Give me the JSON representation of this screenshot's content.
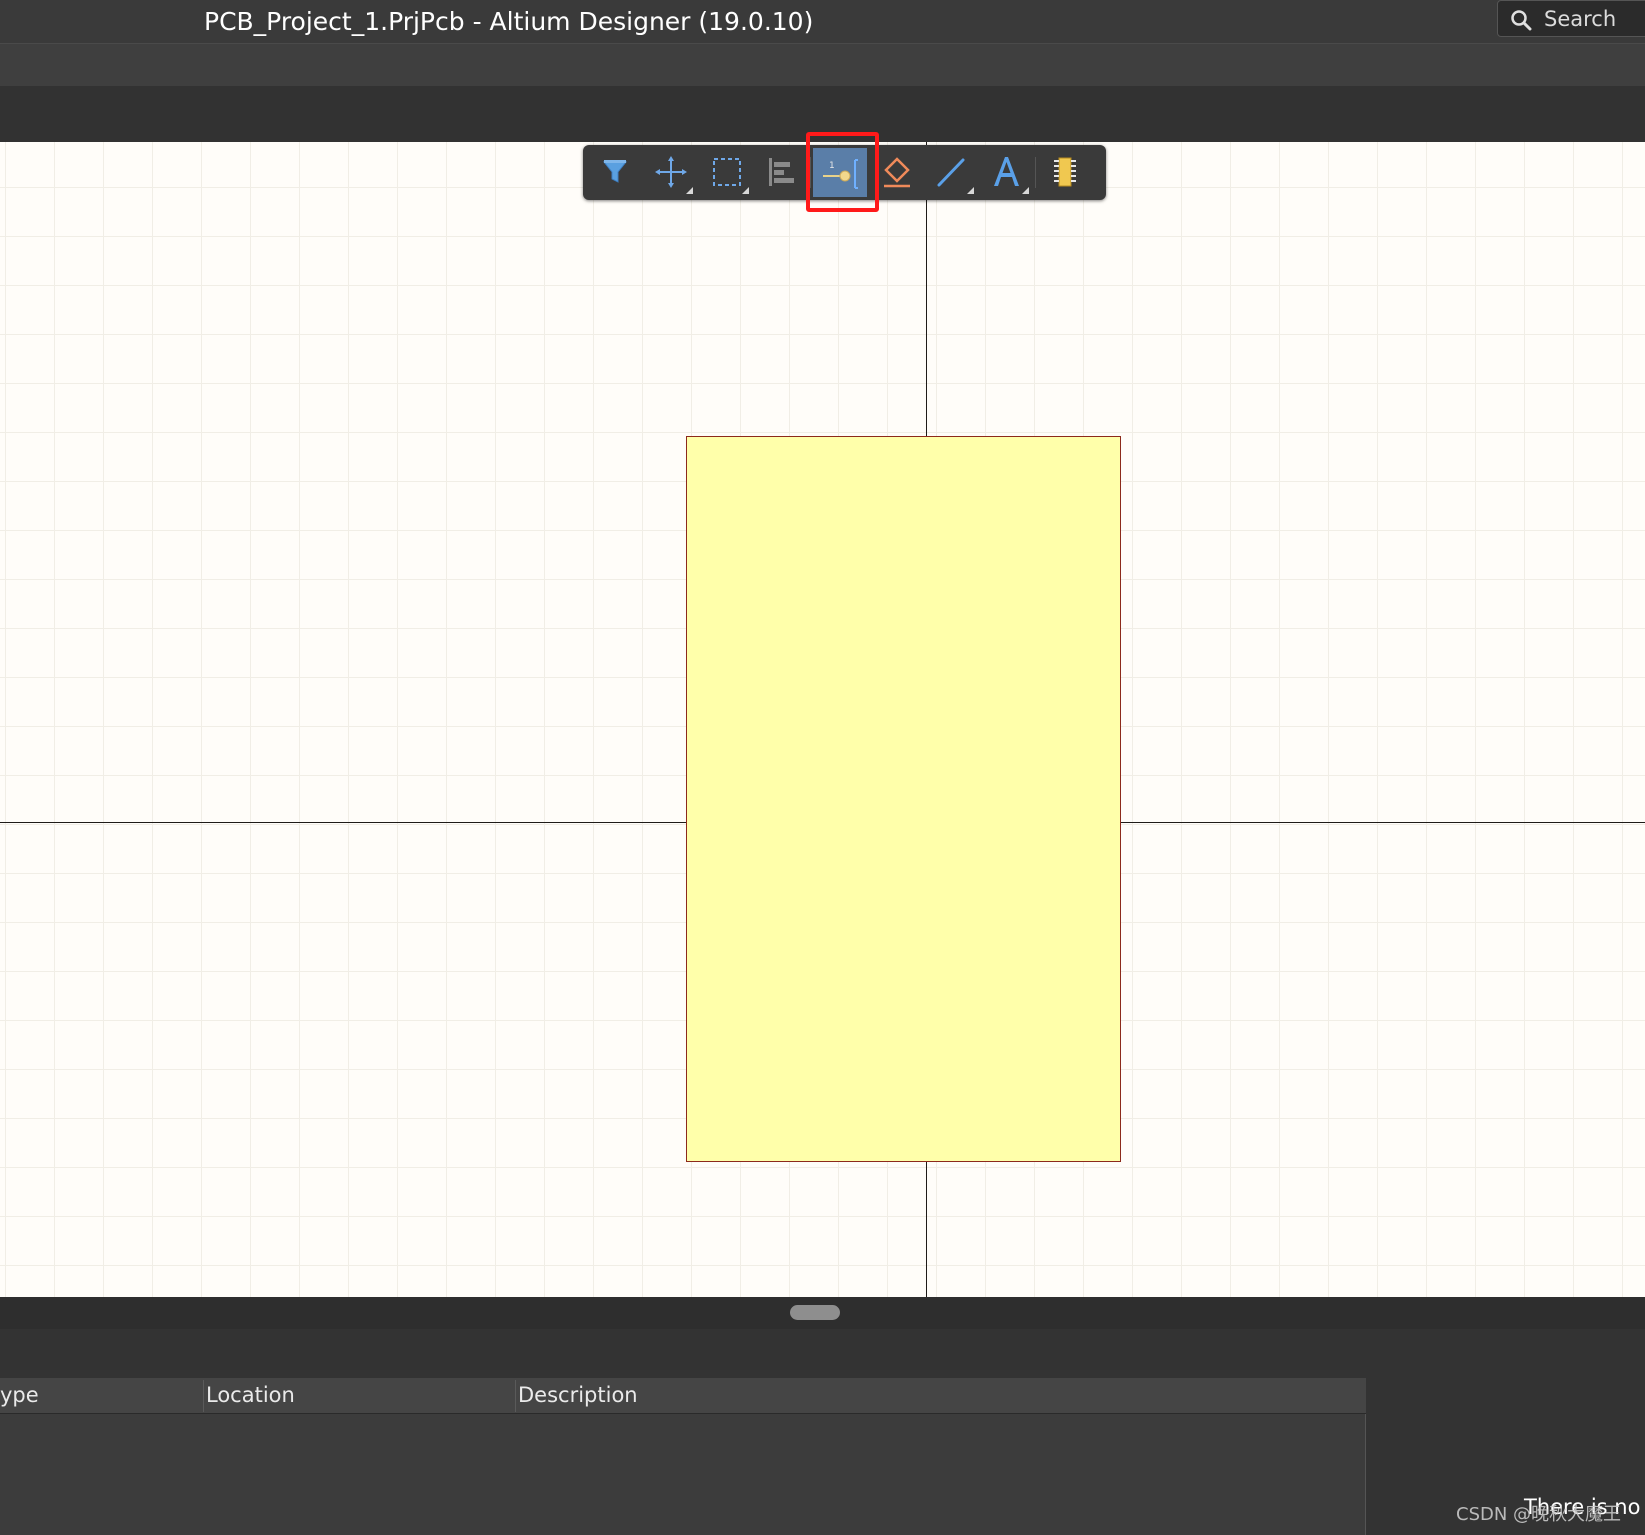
{
  "window": {
    "title": "PCB_Project_1.PrjPcb - Altium Designer (19.0.10)"
  },
  "search": {
    "label": "Search"
  },
  "toolbar": {
    "tools": [
      {
        "name": "filter-icon",
        "has_submenu": false
      },
      {
        "name": "move-icon",
        "has_submenu": true
      },
      {
        "name": "select-rect-icon",
        "has_submenu": true
      },
      {
        "name": "align-icon",
        "has_submenu": false
      },
      {
        "name": "place-pin-icon",
        "has_submenu": false,
        "active": true
      },
      {
        "name": "eraser-icon",
        "has_submenu": false
      },
      {
        "name": "line-icon",
        "has_submenu": true
      },
      {
        "name": "text-icon",
        "has_submenu": true
      },
      {
        "name": "component-icon",
        "has_submenu": false
      }
    ],
    "active_tool": "place-pin-icon",
    "highlight_color": "#ff1a1a"
  },
  "canvas": {
    "background_color": "#fffdf9",
    "component_fill": "#ffffaa",
    "component_border": "#8c2a1b"
  },
  "messages": {
    "columns": [
      "ype",
      "Location",
      "Description"
    ],
    "empty_text": "There is no p"
  },
  "watermark": "CSDN @晚秋大魔王"
}
